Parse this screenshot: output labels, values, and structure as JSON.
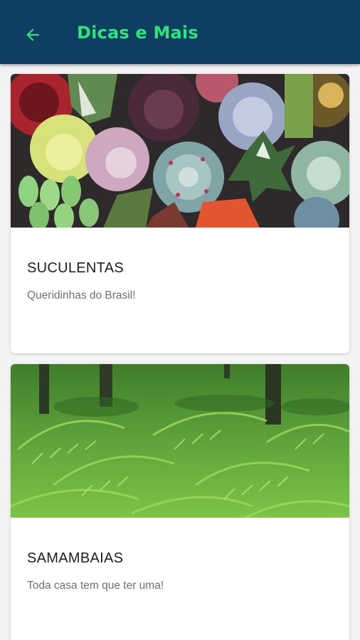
{
  "appbar": {
    "title": "Dicas e Mais",
    "back_icon": "arrow-left-icon",
    "background": "#0e3f62",
    "accent": "#2ee57a"
  },
  "cards": [
    {
      "title": "SUCULENTAS",
      "subtitle": "Queridinhas do Brasil!",
      "image": "succulents-photo"
    },
    {
      "title": "SAMAMBAIAS",
      "subtitle": "Toda casa tem que ter uma!",
      "image": "ferns-photo"
    }
  ]
}
